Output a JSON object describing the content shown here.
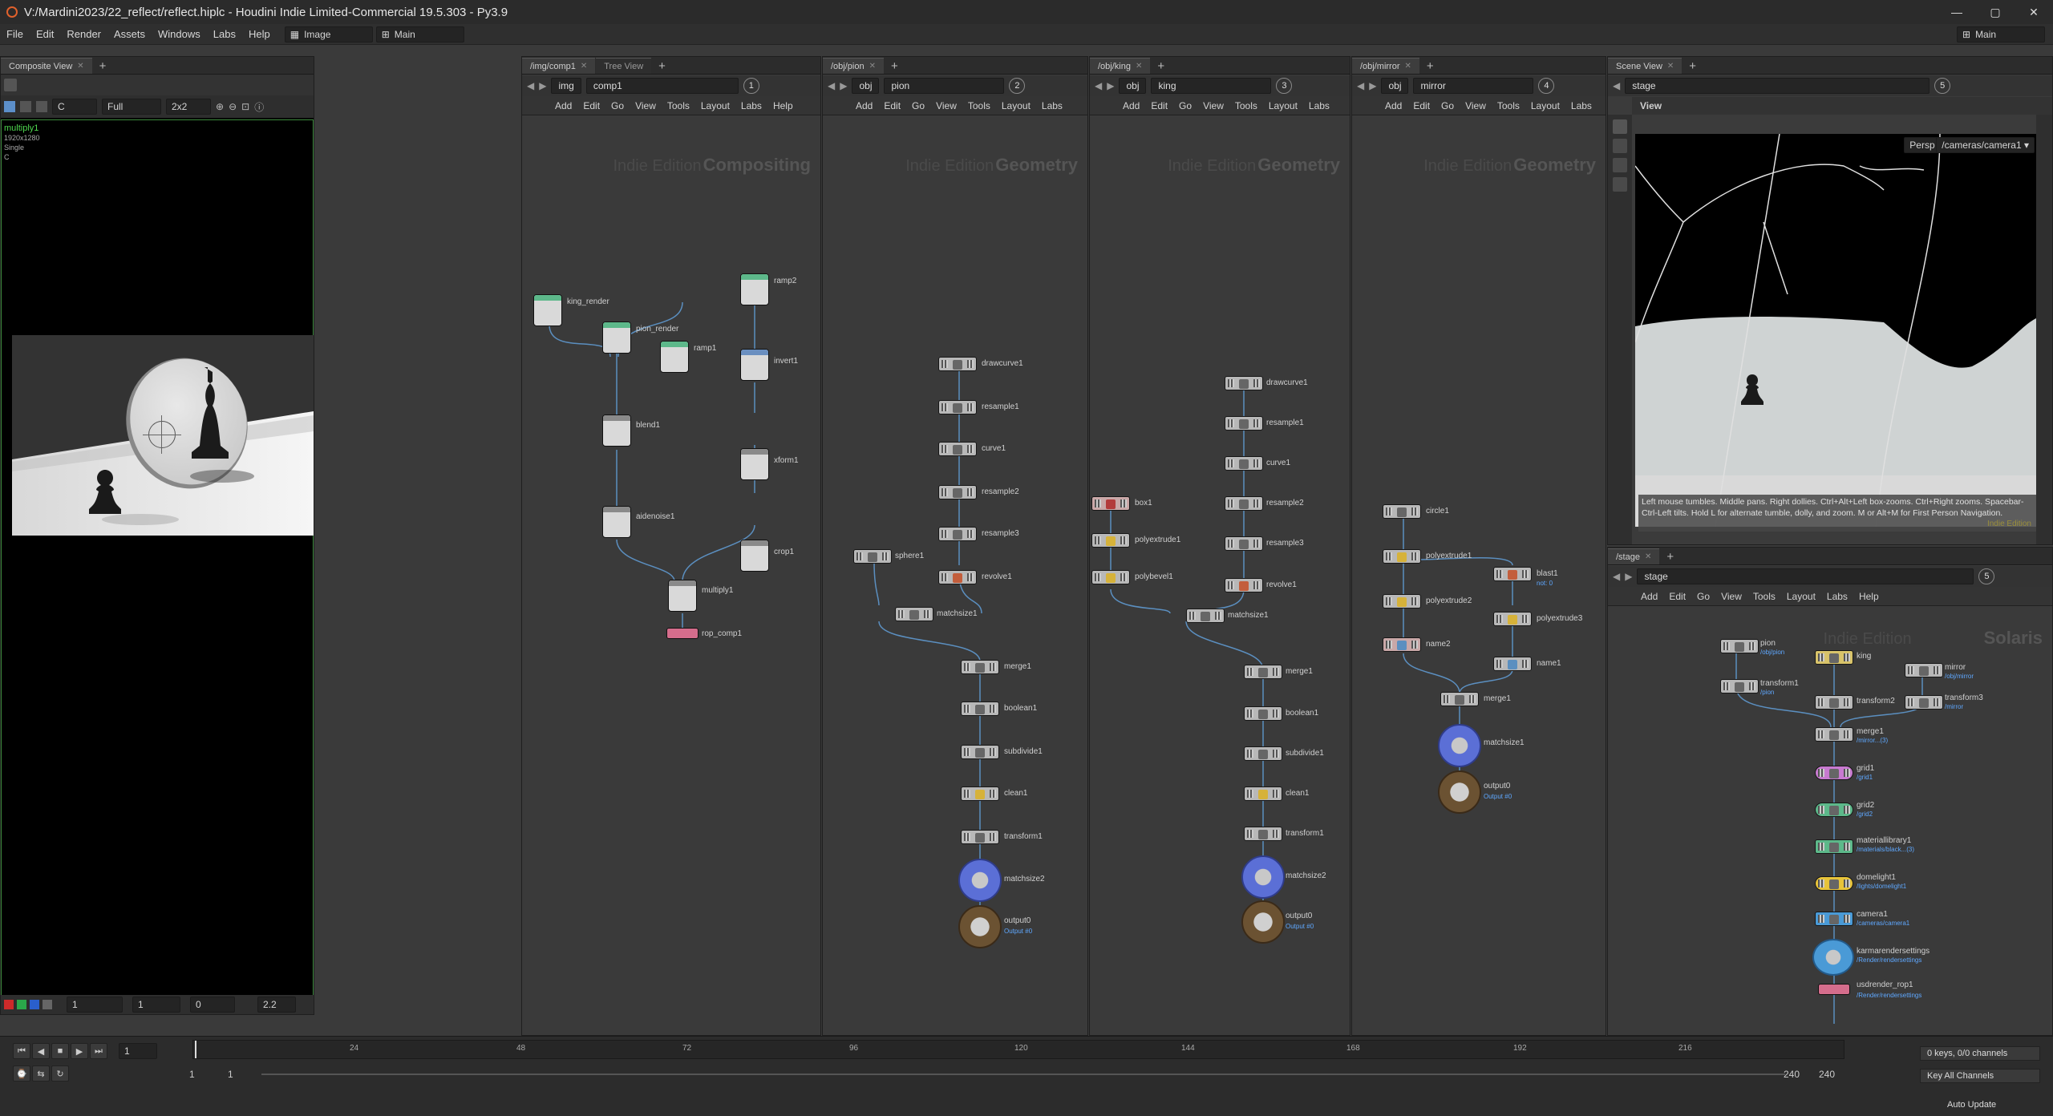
{
  "window": {
    "title": "V:/Mardini2023/22_reflect/reflect.hiplc - Houdini Indie Limited-Commercial 19.5.303 - Py3.9",
    "controls": [
      "—",
      "▢",
      "✕"
    ]
  },
  "menubar": {
    "items": [
      "File",
      "Edit",
      "Render",
      "Assets",
      "Windows",
      "Labs",
      "Help"
    ],
    "desktop_combo": "Image",
    "desktop_combo2": "Main",
    "right_combo": "Main"
  },
  "composite_view": {
    "tab": "Composite View",
    "channel": "C",
    "res": "Full",
    "grid": "2x2",
    "info": {
      "name": "multiply1",
      "res": "1920x1280",
      "mode": "Single",
      "plane": "C"
    },
    "bottom": {
      "frame1": "1",
      "frame2": "1",
      "val0": "0",
      "gamma": "2.2"
    }
  },
  "comp_pane": {
    "tab1": "/img/comp1",
    "tab2": "Tree View",
    "path_root": "img",
    "path_node": "comp1",
    "num": "1",
    "menu": [
      "Add",
      "Edit",
      "Go",
      "View",
      "Tools",
      "Layout",
      "Labs",
      "Help"
    ],
    "watermark_edition": "Indie Edition",
    "watermark": "Compositing",
    "nodes": [
      "king_render",
      "pion_render",
      "ramp1",
      "ramp2",
      "invert1",
      "blend1",
      "xform1",
      "aidenoise1",
      "crop1",
      "multiply1",
      "rop_comp1"
    ]
  },
  "pion_pane": {
    "tab": "/obj/pion",
    "path_root": "obj",
    "path_node": "pion",
    "num": "2",
    "menu": [
      "Add",
      "Edit",
      "Go",
      "View",
      "Tools",
      "Layout",
      "Labs"
    ],
    "watermark_edition": "Indie Edition",
    "watermark": "Geometry",
    "nodes": [
      "drawcurve1",
      "resample1",
      "curve1",
      "resample2",
      "resample3",
      "revolve1",
      "sphere1",
      "matchsize1",
      "merge1",
      "boolean1",
      "subdivide1",
      "clean1",
      "transform1",
      "matchsize2",
      "output0"
    ],
    "output_sub": "Output #0"
  },
  "king_pane": {
    "tab": "/obj/king",
    "path_root": "obj",
    "path_node": "king",
    "num": "3",
    "menu": [
      "Add",
      "Edit",
      "Go",
      "View",
      "Tools",
      "Layout",
      "Labs"
    ],
    "watermark_edition": "Indie Edition",
    "watermark": "Geometry",
    "nodes": [
      "drawcurve1",
      "resample1",
      "curve1",
      "resample2",
      "resample3",
      "revolve1",
      "box1",
      "polyextrude1",
      "polybevel1",
      "matchsize1",
      "merge1",
      "boolean1",
      "subdivide1",
      "clean1",
      "transform1",
      "matchsize2",
      "output0"
    ],
    "output_sub": "Output #0"
  },
  "mirror_pane": {
    "tab": "/obj/mirror",
    "path_root": "obj",
    "path_node": "mirror",
    "num": "4",
    "menu": [
      "Add",
      "Edit",
      "Go",
      "View",
      "Tools",
      "Layout",
      "Labs"
    ],
    "watermark_edition": "Indie Edition",
    "watermark": "Geometry",
    "nodes": [
      "circle1",
      "polyextrude1",
      "polyextrude2",
      "blast1",
      "polyextrude3",
      "name2",
      "name1",
      "merge1",
      "matchsize1",
      "output0"
    ],
    "blast_sub": "not: 0",
    "output_sub": "Output #0"
  },
  "scene_view": {
    "tab": "Scene View",
    "path_node": "stage",
    "num": "5",
    "view_label": "View",
    "persp": "Persp ▾",
    "camera": "/cameras/camera1 ▾",
    "hint": "Left mouse tumbles. Middle pans. Right dollies. Ctrl+Alt+Left box-zooms. Ctrl+Right zooms. Spacebar-Ctrl-Left tilts. Hold L for alternate tumble, dolly, and zoom.    M or Alt+M for First Person Navigation.",
    "hint_watermark": "Indie Edition"
  },
  "stage_pane": {
    "tab": "/stage",
    "path_node": "stage",
    "num": "5",
    "menu": [
      "Add",
      "Edit",
      "Go",
      "View",
      "Tools",
      "Layout",
      "Labs",
      "Help"
    ],
    "watermark_edition": "Indie Edition",
    "watermark": "Solaris",
    "nodes": [
      "pion",
      "king",
      "mirror",
      "transform1",
      "transform2",
      "transform3",
      "merge1",
      "grid1",
      "grid2",
      "materiallibrary1",
      "domelight1",
      "camera1",
      "karmarendersettings",
      "usdrender_rop1"
    ],
    "subs": {
      "pion": "/obj/pion",
      "transform1": "/pion",
      "mirror": "/obj/mirror",
      "transform3": "/mirror",
      "merge1": "/mirror...(3)",
      "grid1": "/grid1",
      "grid2": "/grid2",
      "materiallibrary1": "/materials/black...(3)",
      "domelight1": "/lights/domelight1",
      "camera1": "/cameras/camera1",
      "karmarendersettings": "/Render/rendersettings",
      "usdrender_rop1": "/Render/rendersettings"
    }
  },
  "timeline": {
    "ticks": [
      "24",
      "48",
      "72",
      "96",
      "120",
      "144",
      "168",
      "192",
      "216"
    ],
    "current_frame": "1",
    "start": "1",
    "start2": "1",
    "end": "240",
    "end2": "240",
    "keys": "0 keys, 0/0 channels",
    "key_all": "Key All Channels",
    "auto_update": "Auto Update"
  },
  "colors": {
    "bg": "#3a3a3a",
    "green_sel": "#4ca24c",
    "blue_link": "#5fa8ff",
    "node_green": "#5db88a",
    "node_pink": "#d56d8c"
  }
}
